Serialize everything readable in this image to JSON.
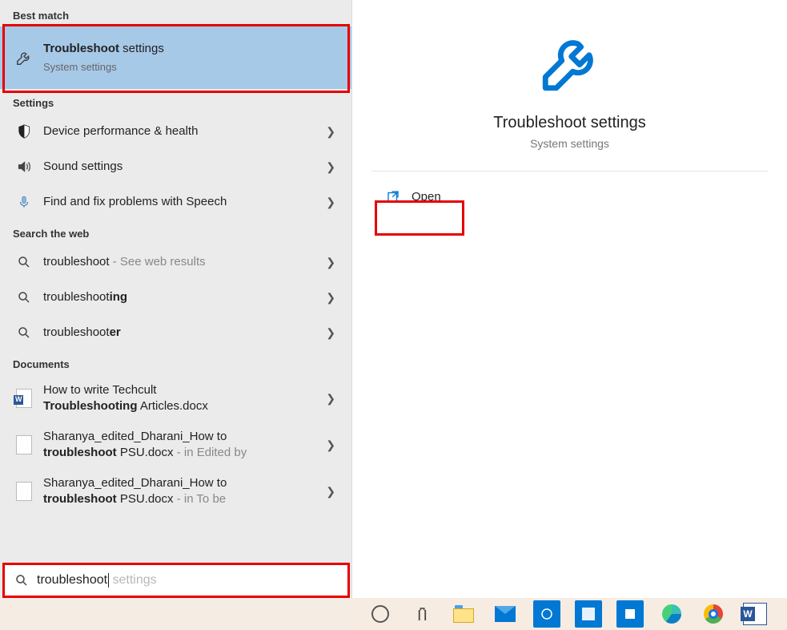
{
  "sections": {
    "best_match": "Best match",
    "settings": "Settings",
    "search_web": "Search the web",
    "documents": "Documents"
  },
  "best_match": {
    "title_prefix": "Troubleshoot",
    "title_suffix": " settings",
    "subtitle": "System settings"
  },
  "settings_items": [
    {
      "label": "Device performance & health",
      "icon": "shield"
    },
    {
      "label": "Sound settings",
      "icon": "sound"
    },
    {
      "label": "Find and fix problems with Speech",
      "icon": "mic"
    }
  ],
  "web_items": [
    {
      "prefix": "troubleshoot",
      "bold_suffix": "",
      "meta": " - See web results"
    },
    {
      "prefix": "troubleshoot",
      "bold_suffix": "ing",
      "meta": ""
    },
    {
      "prefix": "troubleshoot",
      "bold_suffix": "er",
      "meta": ""
    }
  ],
  "doc_items": [
    {
      "line1_a": "How to write Techcult ",
      "line1_b": "",
      "line2_a": "Troubleshooting",
      "line2_b": " Articles.docx",
      "meta": "",
      "word": true
    },
    {
      "line1_a": "Sharanya_edited_Dharani_How to ",
      "line1_b": "",
      "line2_a": "troubleshoot",
      "line2_b": " PSU.docx",
      "meta": " - in Edited by",
      "word": false
    },
    {
      "line1_a": "Sharanya_edited_Dharani_How to ",
      "line1_b": "",
      "line2_a": "troubleshoot",
      "line2_b": " PSU.docx",
      "meta": " - in To be",
      "word": false
    }
  ],
  "right": {
    "title": "Troubleshoot settings",
    "subtitle": "System settings",
    "open": "Open"
  },
  "search": {
    "typed": "troubleshoot",
    "ghost": " settings"
  },
  "taskbar_partial": true
}
